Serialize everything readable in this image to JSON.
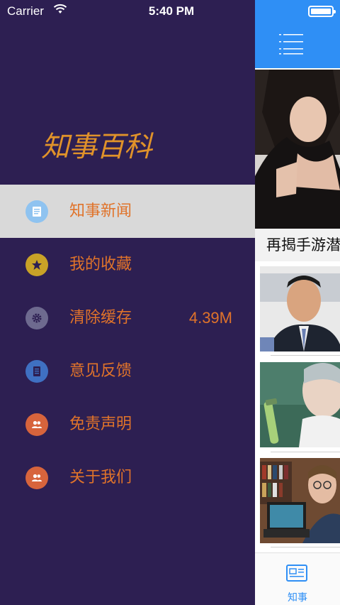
{
  "status_bar": {
    "carrier": "Carrier",
    "time": "5:40 PM"
  },
  "drawer": {
    "logo_text": "知事百科",
    "logo_color": "#e0922a",
    "menu": [
      {
        "label": "知事新闻",
        "icon": "news-icon",
        "icon_color": "#8fc3f0",
        "active": true
      },
      {
        "label": "我的收藏",
        "icon": "star-icon",
        "icon_color": "#c9a227"
      },
      {
        "label": "清除缓存",
        "icon": "gear-icon",
        "icon_color": "#6e6a8f",
        "value": "4.39M"
      },
      {
        "label": "意见反馈",
        "icon": "document-icon",
        "icon_color": "#3f70c2"
      },
      {
        "label": "免责声明",
        "icon": "users-icon",
        "icon_color": "#d7643c"
      },
      {
        "label": "关于我们",
        "icon": "users-icon",
        "icon_color": "#d7643c"
      }
    ],
    "label_color": "#e0732a",
    "background": "#2d1f52"
  },
  "content": {
    "navbar_color": "#2f8ff5",
    "hero_caption": "再揭手游潜",
    "tab": {
      "label": "知事",
      "icon": "newspaper-icon"
    }
  }
}
